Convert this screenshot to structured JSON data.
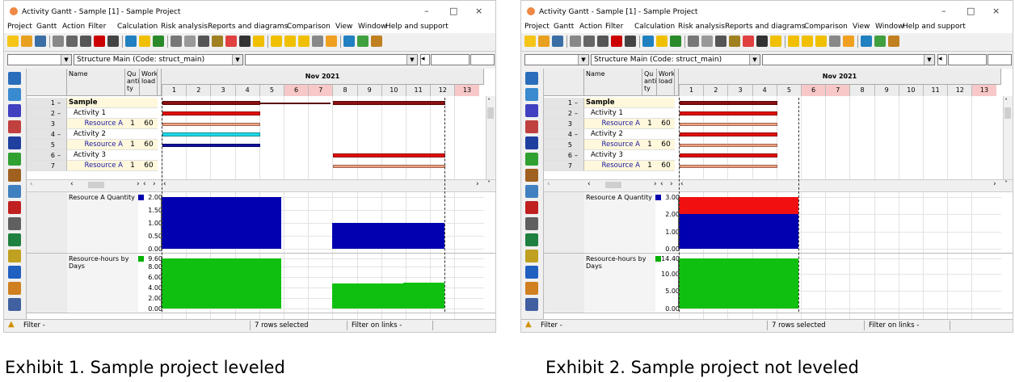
{
  "windows": [
    {
      "id": "w1",
      "title": "Activity Gantt - Sample [1] - Sample Project",
      "menu": [
        "Project",
        "Gantt",
        "Action",
        "Filter",
        "Calculation",
        "Risk analysis",
        "Reports and diagrams",
        "Comparison",
        "View",
        "Window",
        "Help and support"
      ],
      "structure_combo": "Structure Main (Code: struct_main)",
      "columns": {
        "name": "Name",
        "quantity": "Qu anti ty",
        "workload": "Work load"
      },
      "month": "Nov 2021",
      "days": [
        "1",
        "2",
        "3",
        "4",
        "5",
        "6",
        "7",
        "8",
        "9",
        "10",
        "11",
        "12",
        "13"
      ],
      "weekend_days": [
        6,
        7,
        13
      ],
      "rows": [
        {
          "num": "1",
          "toggle": "–",
          "name": "Sample Project",
          "qty": "",
          "load": "",
          "type": "project"
        },
        {
          "num": "2",
          "toggle": "–",
          "name": "Activity 1",
          "qty": "",
          "load": "",
          "type": "activity"
        },
        {
          "num": "3",
          "toggle": "",
          "name": "Resource A",
          "qty": "1",
          "load": "60",
          "type": "resource"
        },
        {
          "num": "4",
          "toggle": "–",
          "name": "Activity 2",
          "qty": "",
          "load": "",
          "type": "activity"
        },
        {
          "num": "5",
          "toggle": "",
          "name": "Resource A",
          "qty": "1",
          "load": "60",
          "type": "resource"
        },
        {
          "num": "6",
          "toggle": "–",
          "name": "Activity 3",
          "qty": "",
          "load": "",
          "type": "activity"
        },
        {
          "num": "7",
          "toggle": "",
          "name": "Resource A",
          "qty": "1",
          "load": "60",
          "type": "resource"
        }
      ],
      "bars": [
        {
          "row": 0,
          "start": 1,
          "end": 5,
          "color": "#8b1010",
          "h": 5
        },
        {
          "row": 0,
          "start": 5,
          "end": 7.9,
          "color": "#8b1010",
          "h": 2
        },
        {
          "row": 0,
          "start": 8,
          "end": 12.6,
          "color": "#8b1010",
          "h": 5
        },
        {
          "row": 1,
          "start": 1,
          "end": 5,
          "color": "#e01010",
          "h": 5
        },
        {
          "row": 2,
          "start": 1,
          "end": 5,
          "color": "#f0a080",
          "h": 4
        },
        {
          "row": 3,
          "start": 1,
          "end": 5,
          "color": "#20d8e8",
          "h": 5
        },
        {
          "row": 4,
          "start": 1,
          "end": 5,
          "color": "#1010a0",
          "h": 4
        },
        {
          "row": 5,
          "start": 8,
          "end": 12.6,
          "color": "#e01010",
          "h": 5
        },
        {
          "row": 6,
          "start": 8,
          "end": 12.6,
          "color": "#f0a080",
          "h": 4
        }
      ],
      "histogram1": {
        "label": "Resource A Quantity",
        "swatch": "#0000b0",
        "ticks": [
          "2.00",
          "1.50",
          "1.00",
          "0.50",
          "0.00"
        ],
        "max": 2,
        "blocks": [
          {
            "start": 1,
            "end": 5.9,
            "value": 2,
            "color": "#0000b0"
          },
          {
            "start": 8,
            "end": 12.6,
            "value": 1,
            "color": "#0000b0"
          }
        ]
      },
      "histogram2": {
        "label": "Resource-hours by Days",
        "swatch": "#00b000",
        "ticks": [
          "9.60",
          "8.00",
          "6.00",
          "4.00",
          "2.00",
          "0.00"
        ],
        "max": 9.6,
        "blocks": [
          {
            "start": 1,
            "end": 5.9,
            "value": 9.6,
            "color": "#10c010"
          },
          {
            "start": 8,
            "end": 10.9,
            "value": 4.8,
            "color": "#10c010"
          },
          {
            "start": 10.9,
            "end": 12.6,
            "value": 5.0,
            "color": "#10c010"
          }
        ]
      },
      "status": {
        "filter": "Filter -",
        "selected": "7 rows selected",
        "links": "Filter on links -"
      }
    },
    {
      "id": "w2",
      "title": "Activity Gantt - Sample [1] - Sample Project",
      "menu": [
        "Project",
        "Gantt",
        "Action",
        "Filter",
        "Calculation",
        "Risk analysis",
        "Reports and diagrams",
        "Comparison",
        "View",
        "Window",
        "Help and support"
      ],
      "structure_combo": "Structure Main (Code: struct_main)",
      "columns": {
        "name": "Name",
        "quantity": "Qu anti ty",
        "workload": "Work load"
      },
      "month": "Nov 2021",
      "days": [
        "1",
        "2",
        "3",
        "4",
        "5",
        "6",
        "7",
        "8",
        "9",
        "10",
        "11",
        "12",
        "13"
      ],
      "weekend_days": [
        6,
        7,
        13
      ],
      "rows": [
        {
          "num": "1",
          "toggle": "–",
          "name": "Sample Project",
          "qty": "",
          "load": "",
          "type": "project"
        },
        {
          "num": "2",
          "toggle": "–",
          "name": "Activity 1",
          "qty": "",
          "load": "",
          "type": "activity"
        },
        {
          "num": "3",
          "toggle": "",
          "name": "Resource A",
          "qty": "1",
          "load": "60",
          "type": "resource"
        },
        {
          "num": "4",
          "toggle": "–",
          "name": "Activity 2",
          "qty": "",
          "load": "",
          "type": "activity"
        },
        {
          "num": "5",
          "toggle": "",
          "name": "Resource A",
          "qty": "1",
          "load": "60",
          "type": "resource"
        },
        {
          "num": "6",
          "toggle": "–",
          "name": "Activity 3",
          "qty": "",
          "load": "",
          "type": "activity"
        },
        {
          "num": "7",
          "toggle": "",
          "name": "Resource A",
          "qty": "1",
          "load": "60",
          "type": "resource"
        }
      ],
      "bars": [
        {
          "row": 0,
          "start": 1,
          "end": 5,
          "color": "#8b1010",
          "h": 5
        },
        {
          "row": 1,
          "start": 1,
          "end": 5,
          "color": "#e01010",
          "h": 5
        },
        {
          "row": 2,
          "start": 1,
          "end": 5,
          "color": "#f0a080",
          "h": 4
        },
        {
          "row": 3,
          "start": 1,
          "end": 5,
          "color": "#e01010",
          "h": 5
        },
        {
          "row": 4,
          "start": 1,
          "end": 5,
          "color": "#f0a080",
          "h": 4
        },
        {
          "row": 5,
          "start": 1,
          "end": 5,
          "color": "#e01010",
          "h": 5
        },
        {
          "row": 6,
          "start": 1,
          "end": 5,
          "color": "#f0a080",
          "h": 4
        }
      ],
      "histogram1": {
        "label": "Resource A Quantity",
        "swatch": "#0000b0",
        "ticks": [
          "3.00",
          "2.00",
          "1.00",
          "0.00"
        ],
        "max": 3,
        "blocks": [
          {
            "start": 1,
            "end": 5.9,
            "value": 3,
            "color": "#f01010"
          },
          {
            "start": 1,
            "end": 5.9,
            "value": 2,
            "color": "#0000b0"
          }
        ]
      },
      "histogram2": {
        "label": "Resource-hours by Days",
        "swatch": "#00b000",
        "ticks": [
          "14.40",
          "10.00",
          "5.00",
          "0.00"
        ],
        "max": 14.4,
        "blocks": [
          {
            "start": 1,
            "end": 5.9,
            "value": 14.4,
            "color": "#10c010"
          }
        ]
      },
      "status": {
        "filter": "Filter -",
        "selected": "7 rows selected",
        "links": "Filter on links -"
      }
    }
  ],
  "captions": [
    "Exhibit 1. Sample project leveled",
    "Exhibit 2. Sample project not leveled"
  ]
}
